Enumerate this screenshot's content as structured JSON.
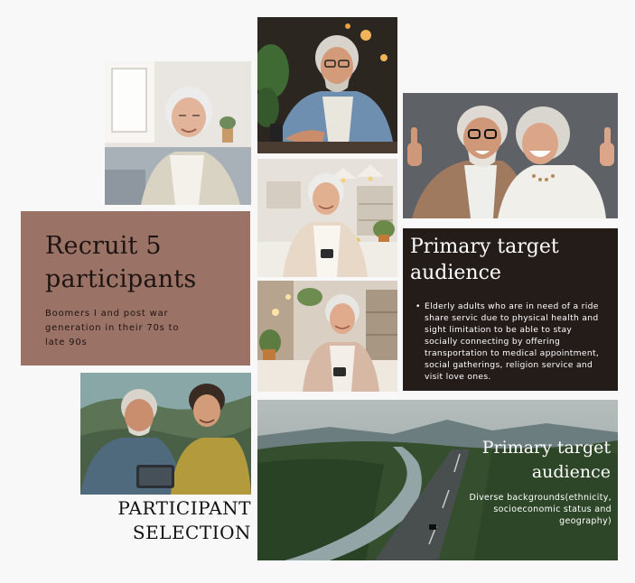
{
  "recruit": {
    "title": "Recruit 5 participants",
    "description": "Boomers I and post war generation in their 70s to late 90s"
  },
  "target": {
    "title": "Primary target audience",
    "bullets": [
      "Elderly adults who are in need of a ride share servic due to physical health and sight limitation to be able to stay socially connecting by offering transportation to medical appointment, social gatherings, religion service and visit love ones."
    ]
  },
  "landscape": {
    "title": "Primary target audience",
    "description": "Diverse backgrounds(ethnicity, socioeconomic status and geography)"
  },
  "selection": {
    "line1": "PARTICIPANT",
    "line2": "SELECTION"
  },
  "colors": {
    "recruit_card": "#9b7266",
    "target_card": "#231c19",
    "page_background": "#f8f8f9"
  }
}
